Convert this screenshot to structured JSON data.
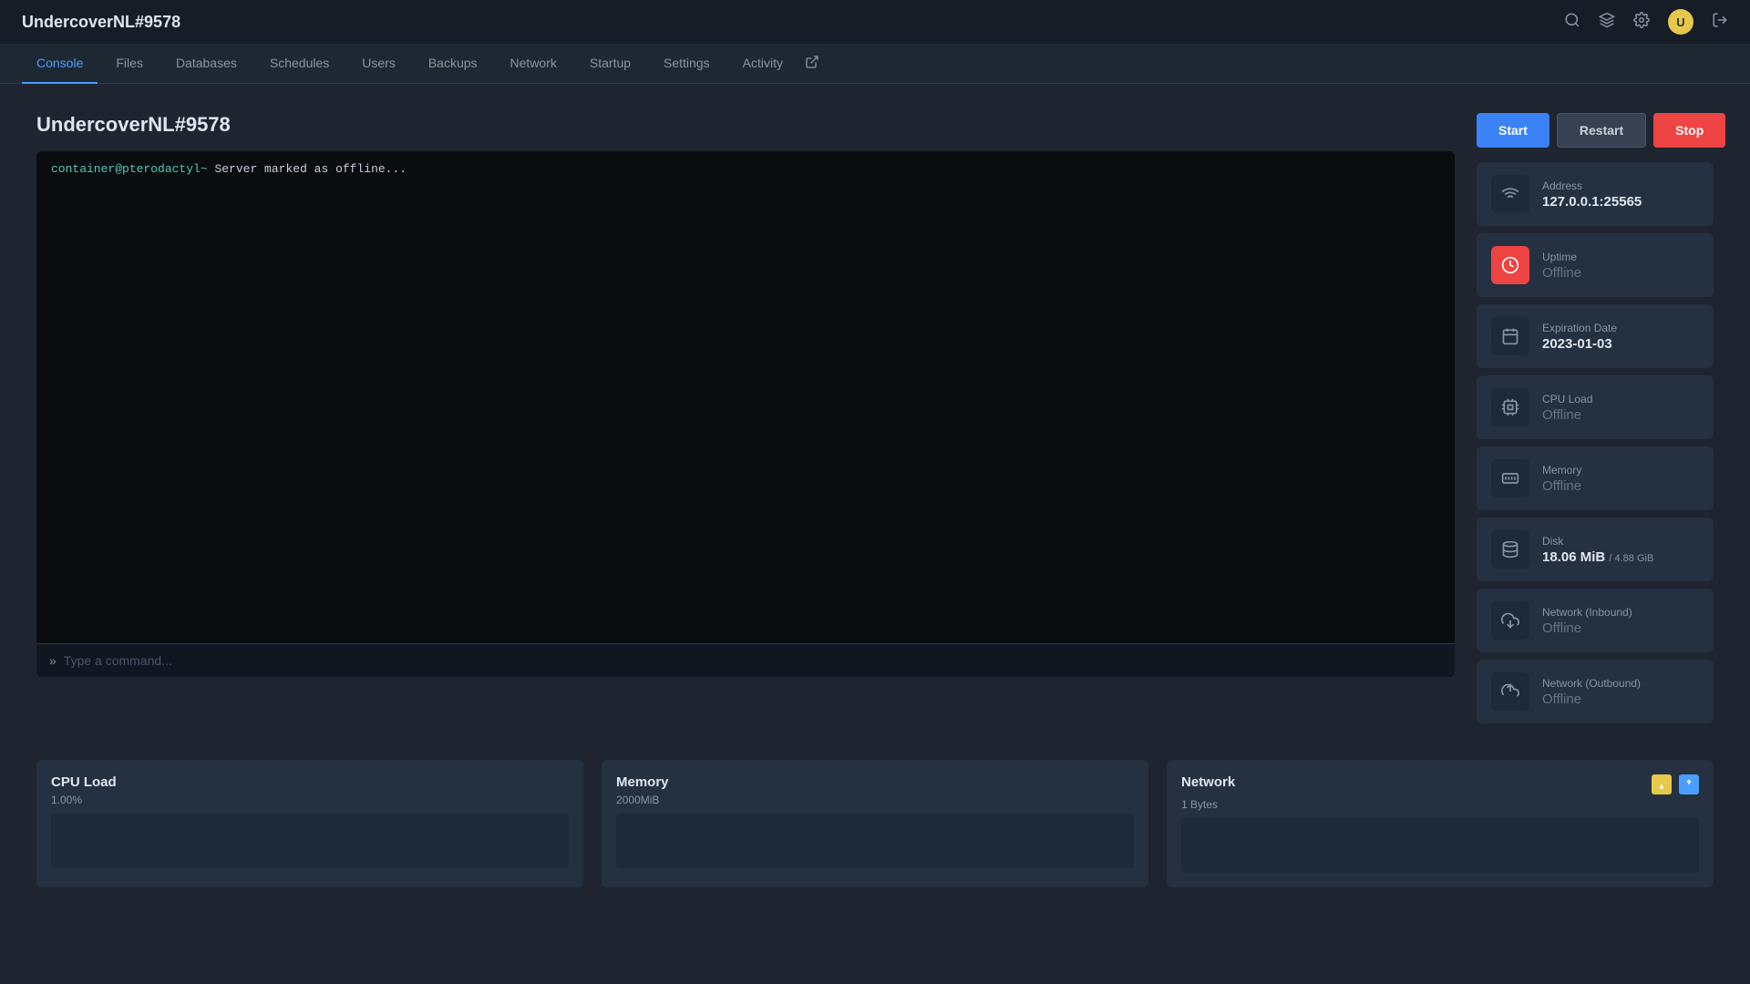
{
  "topbar": {
    "title": "UndercoverNL#9578",
    "icons": {
      "search": "🔍",
      "layers": "⊞",
      "settings": "⚙",
      "logout": "→"
    }
  },
  "nav": {
    "tabs": [
      {
        "id": "console",
        "label": "Console",
        "active": true
      },
      {
        "id": "files",
        "label": "Files",
        "active": false
      },
      {
        "id": "databases",
        "label": "Databases",
        "active": false
      },
      {
        "id": "schedules",
        "label": "Schedules",
        "active": false
      },
      {
        "id": "users",
        "label": "Users",
        "active": false
      },
      {
        "id": "backups",
        "label": "Backups",
        "active": false
      },
      {
        "id": "network",
        "label": "Network",
        "active": false
      },
      {
        "id": "startup",
        "label": "Startup",
        "active": false
      },
      {
        "id": "settings",
        "label": "Settings",
        "active": false
      },
      {
        "id": "activity",
        "label": "Activity",
        "active": false
      }
    ]
  },
  "page": {
    "server_title": "UndercoverNL#9578",
    "console_output": "container@pterodactyl~ Server marked as offline...",
    "console_placeholder": "Type a command..."
  },
  "buttons": {
    "start": "Start",
    "restart": "Restart",
    "stop": "Stop"
  },
  "stats": {
    "address": {
      "label": "Address",
      "value": "127.0.0.1:25565"
    },
    "uptime": {
      "label": "Uptime",
      "value": "Offline",
      "offline": true
    },
    "expiration": {
      "label": "Expiration Date",
      "value": "2023-01-03"
    },
    "cpu_load": {
      "label": "CPU Load",
      "value": "Offline",
      "offline": true
    },
    "memory": {
      "label": "Memory",
      "value": "Offline",
      "offline": true
    },
    "disk": {
      "label": "Disk",
      "value": "18.06 MiB",
      "sub": "/ 4.88 GiB"
    },
    "network_inbound": {
      "label": "Network (Inbound)",
      "value": "Offline",
      "offline": true
    },
    "network_outbound": {
      "label": "Network (Outbound)",
      "value": "Offline",
      "offline": true
    }
  },
  "charts": {
    "cpu": {
      "title": "CPU Load",
      "subtitle": "1.00%"
    },
    "memory": {
      "title": "Memory",
      "subtitle": "2000MiB"
    },
    "network": {
      "title": "Network",
      "subtitle": "1 Bytes"
    }
  }
}
